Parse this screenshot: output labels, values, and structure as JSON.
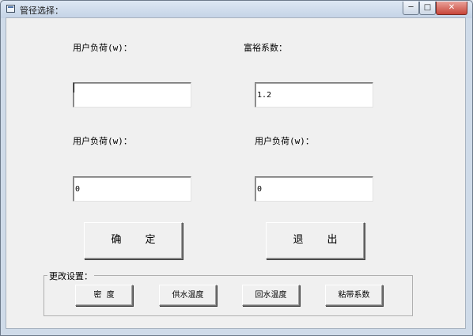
{
  "window": {
    "title": "管径选择：",
    "controls": {
      "minimize": "─",
      "maximize": "□",
      "close": "✕"
    }
  },
  "labels": {
    "user_load_1": "用户负荷(w)：",
    "surplus_coefficient": "富裕系数：",
    "user_load_2": "用户负荷(w)：",
    "user_load_3": "用户负荷(w)："
  },
  "fields": {
    "user_load_1": "",
    "surplus_coefficient": "1.2",
    "user_load_2": "0",
    "user_load_3": "0"
  },
  "buttons": {
    "confirm": "确定",
    "exit": "退出"
  },
  "change_settings": {
    "title": "更改设置：",
    "density": "密  度",
    "supply_temp": "供水温度",
    "return_temp": "回水温度",
    "viscosity": "粘带系数"
  }
}
